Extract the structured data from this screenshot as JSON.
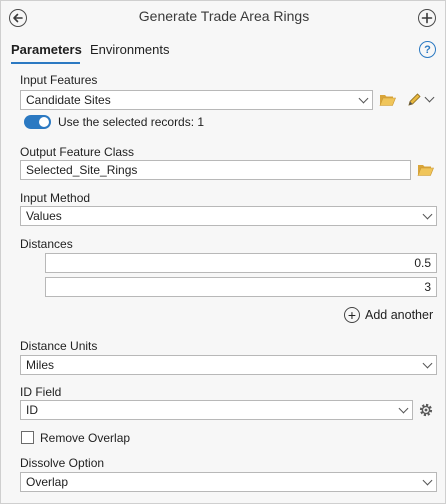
{
  "header": {
    "title": "Generate Trade Area Rings",
    "back_icon": "back-arrow-icon",
    "add_icon": "plus-circle-icon"
  },
  "tabs": [
    {
      "label": "Parameters",
      "active": true
    },
    {
      "label": "Environments",
      "active": false
    }
  ],
  "help_glyph": "?",
  "input_features": {
    "label": "Input Features",
    "value": "Candidate Sites",
    "use_selected_label": "Use the selected records: 1",
    "use_selected_on": true
  },
  "output_feature_class": {
    "label": "Output Feature Class",
    "value": "Selected_Site_Rings"
  },
  "input_method": {
    "label": "Input Method",
    "value": "Values"
  },
  "distances": {
    "label": "Distances",
    "values": [
      "0.5",
      "3"
    ],
    "add_label": "Add another"
  },
  "distance_units": {
    "label": "Distance Units",
    "value": "Miles"
  },
  "id_field": {
    "label": "ID Field",
    "value": "ID"
  },
  "remove_overlap": {
    "label": "Remove Overlap",
    "checked": false
  },
  "dissolve_option": {
    "label": "Dissolve Option",
    "value": "Overlap"
  },
  "colors": {
    "accent": "#2b79c2",
    "folder": "#e9b949",
    "background": "#f7f7f7"
  }
}
